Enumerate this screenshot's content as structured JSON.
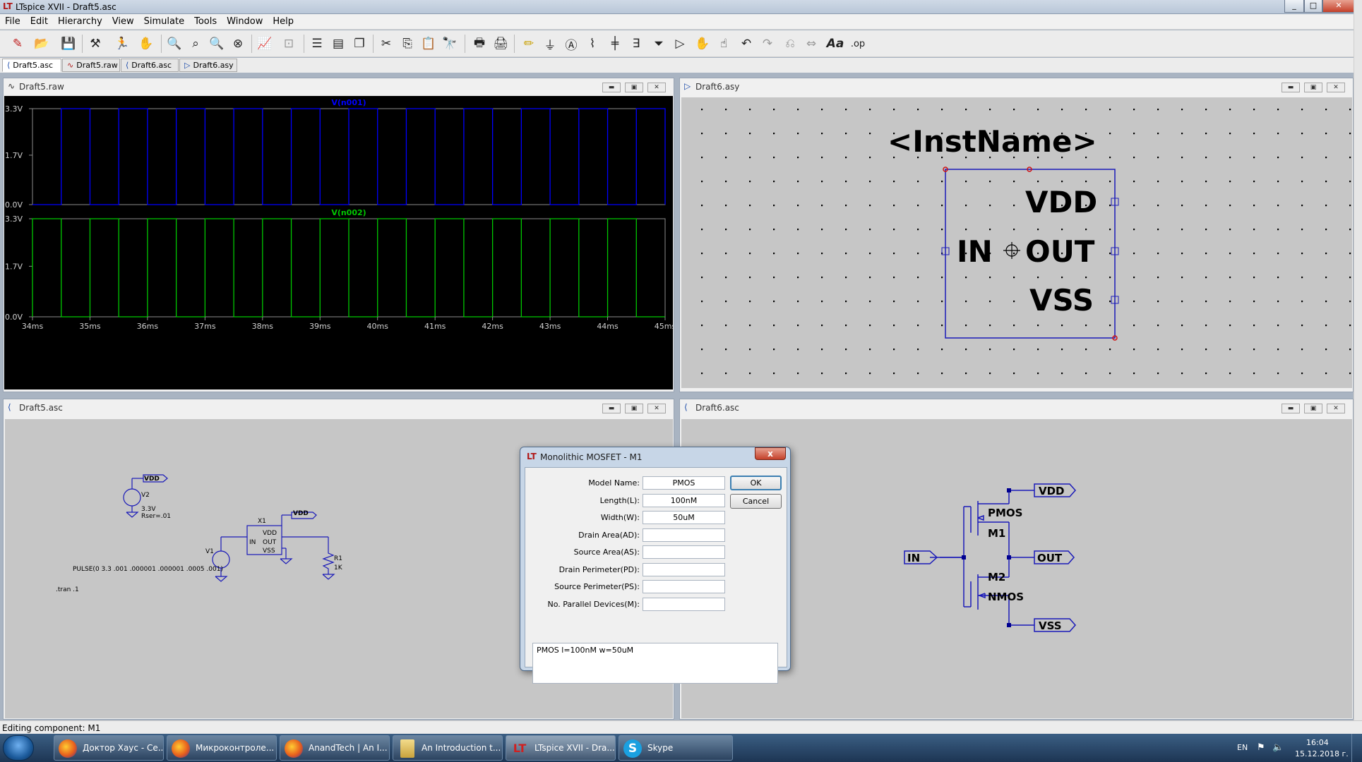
{
  "window": {
    "title": "LTspice XVII - Draft5.asc",
    "controls": [
      "_",
      "□",
      "✕"
    ]
  },
  "menu": [
    "File",
    "Edit",
    "Hierarchy",
    "View",
    "Simulate",
    "Tools",
    "Window",
    "Help"
  ],
  "tabs": [
    {
      "label": "Draft5.asc",
      "icon": "schematic-icon"
    },
    {
      "label": "Draft5.raw",
      "icon": "waveform-icon"
    },
    {
      "label": "Draft6.asc",
      "icon": "schematic-icon"
    },
    {
      "label": "Draft6.asy",
      "icon": "symbol-icon"
    }
  ],
  "subwindows": {
    "raw": {
      "title": "Draft5.raw"
    },
    "asy": {
      "title": "Draft6.asy"
    },
    "asc5": {
      "title": "Draft5.asc"
    },
    "asc6": {
      "title": "Draft6.asc"
    }
  },
  "waveform": {
    "trace1": {
      "name": "V(n001)",
      "color": "#0000ff"
    },
    "trace2": {
      "name": "V(n002)",
      "color": "#00c800"
    },
    "yticks": [
      "3.3V",
      "1.7V",
      "0.0V"
    ],
    "xticks": [
      "34ms",
      "35ms",
      "36ms",
      "37ms",
      "38ms",
      "39ms",
      "40ms",
      "41ms",
      "42ms",
      "43ms",
      "44ms",
      "45ms"
    ],
    "xrange_ms": [
      34,
      45
    ],
    "period_ms": 1,
    "pulse": {
      "v1": 0,
      "v2": 3.3,
      "ton_ms": 0.5
    },
    "trace1_offset_ms": 0.5,
    "trace2_offset_ms": 0.0
  },
  "symbol": {
    "instname": "<InstName>",
    "vdd": "VDD",
    "in": "IN",
    "out": "OUT",
    "vss": "VSS"
  },
  "schem5": {
    "vdd1": "VDD",
    "v2": "V2",
    "v2val": "3.3V",
    "v2rser": "Rser=.01",
    "x1": "X1",
    "x1_vdd": "VDD",
    "x1_in": "IN",
    "x1_out": "OUT",
    "x1_vss": "VSS",
    "vdd2": "VDD",
    "v1": "V1",
    "pulse": "PULSE(0 3.3 .001 .000001 .000001 .0005 .001)",
    "r1": "R1",
    "r1val": "1K",
    "tran": ".tran .1"
  },
  "schem6": {
    "vdd": "VDD",
    "pmos": "PMOS",
    "m1": "M1",
    "in": "IN",
    "out": "OUT",
    "m2": "M2",
    "nmos": "NMOS",
    "vss": "VSS"
  },
  "dialog": {
    "title": "Monolithic MOSFET - M1",
    "close": "x",
    "ok": "OK",
    "cancel": "Cancel",
    "fields": [
      {
        "label": "Model Name:",
        "value": "PMOS"
      },
      {
        "label": "Length(L):",
        "value": "100nM"
      },
      {
        "label": "Width(W):",
        "value": "50uM"
      },
      {
        "label": "Drain Area(AD):",
        "value": ""
      },
      {
        "label": "Source Area(AS):",
        "value": ""
      },
      {
        "label": "Drain Perimeter(PD):",
        "value": ""
      },
      {
        "label": "Source Perimeter(PS):",
        "value": ""
      },
      {
        "label": "No. Parallel Devices(M):",
        "value": ""
      }
    ],
    "spice_line": "PMOS l=100nM w=50uM"
  },
  "status": "Editing component: M1",
  "taskbar": {
    "items": [
      {
        "label": "Доктор Хаус - Се...",
        "icon": "firefox-icon"
      },
      {
        "label": "Микроконтроле...",
        "icon": "firefox-icon"
      },
      {
        "label": "AnandTech | An I...",
        "icon": "firefox-icon"
      },
      {
        "label": "An Introduction t...",
        "icon": "folder-icon"
      },
      {
        "label": "LTspice XVII - Dra...",
        "icon": "ltspice-icon"
      },
      {
        "label": "Skype",
        "icon": "skype-icon"
      }
    ],
    "lang": "EN",
    "time": "16:04",
    "date": "15.12.2018 г."
  }
}
